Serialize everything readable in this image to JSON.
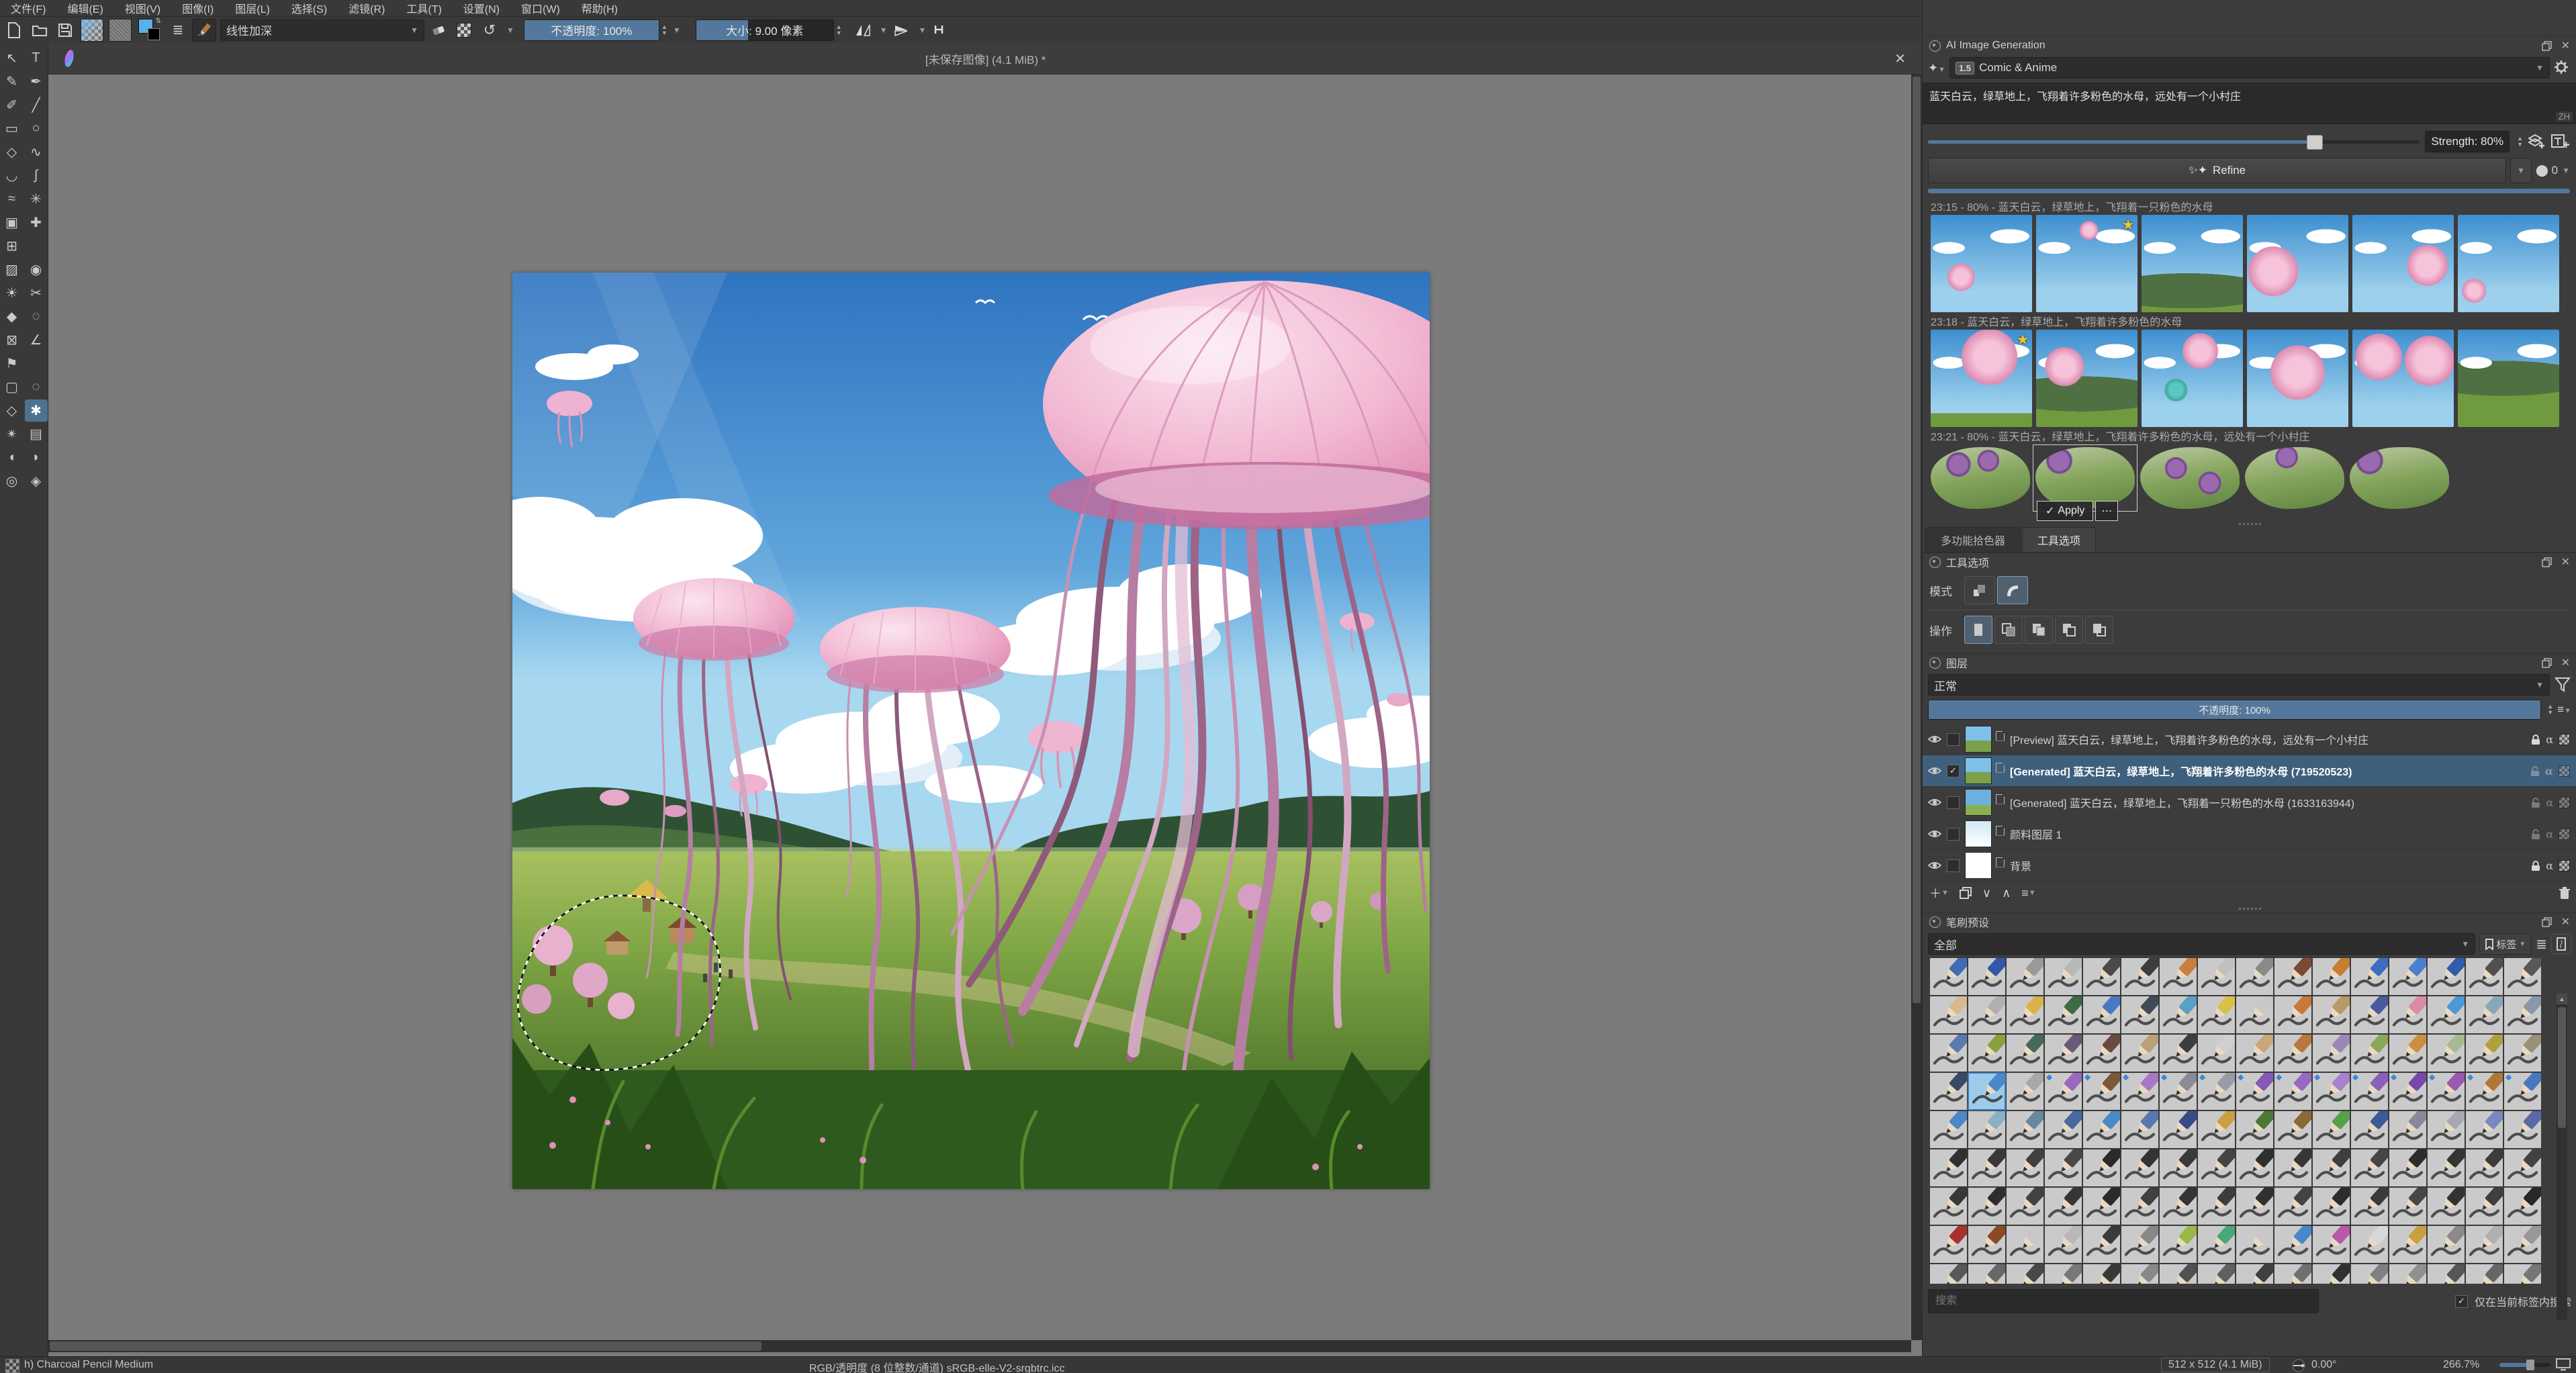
{
  "menu": {
    "items": [
      "文件(F)",
      "编辑(E)",
      "视图(V)",
      "图像(I)",
      "图层(L)",
      "选择(S)",
      "滤镜(R)",
      "工具(T)",
      "设置(N)",
      "窗口(W)",
      "帮助(H)"
    ]
  },
  "toolbar": {
    "blend_mode": "线性加深",
    "opacity_label": "不透明度:  100%",
    "size_label": "大小:  9.00 像素",
    "opacity_pct": 100,
    "size_fill_pct": 38
  },
  "window": {
    "title": "[未保存图像] (4.1 MiB) *",
    "close_label": "✕"
  },
  "tools": {
    "items": [
      {
        "n": "shape-select-tool",
        "g": "↖"
      },
      {
        "n": "text-tool",
        "g": "T"
      },
      {
        "n": "edit-shapes-tool",
        "g": "✎"
      },
      {
        "n": "calligraphy-tool",
        "g": "✒"
      },
      {
        "n": "freehand-brush-tool",
        "g": "✐"
      },
      {
        "n": "line-tool",
        "g": "╱"
      },
      {
        "n": "rectangle-tool",
        "g": "▭"
      },
      {
        "n": "ellipse-tool",
        "g": "○"
      },
      {
        "n": "polygon-tool",
        "g": "◇"
      },
      {
        "n": "polyline-tool",
        "g": "∿"
      },
      {
        "n": "bezier-curve-tool",
        "g": "◡"
      },
      {
        "n": "freehand-path-tool",
        "g": "∫"
      },
      {
        "n": "dynamic-brush-tool",
        "g": "≈"
      },
      {
        "n": "multibrush-tool",
        "g": "✳"
      },
      {
        "n": "transform-tool",
        "g": "▣"
      },
      {
        "n": "move-tool",
        "g": "✚"
      },
      {
        "n": "crop-tool",
        "g": "⊞"
      },
      {
        "n": "spacer",
        "g": ""
      },
      {
        "n": "gradient-tool",
        "g": "▨"
      },
      {
        "n": "color-sampler-tool",
        "g": "◉"
      },
      {
        "n": "colorize-mask-tool",
        "g": "☀"
      },
      {
        "n": "smart-patch-tool",
        "g": "✂"
      },
      {
        "n": "fill-tool",
        "g": "◆"
      },
      {
        "n": "enclose-fill-tool",
        "g": "◌"
      },
      {
        "n": "assistants-tool",
        "g": "⊠"
      },
      {
        "n": "measure-tool",
        "g": "∠"
      },
      {
        "n": "reference-images-tool",
        "g": "⚑"
      },
      {
        "n": "spacer",
        "g": ""
      },
      {
        "n": "rect-select-tool",
        "g": "▢"
      },
      {
        "n": "ellipse-select-tool",
        "g": "◌"
      },
      {
        "n": "polygon-select-tool",
        "g": "◇"
      },
      {
        "n": "freehand-select-tool",
        "g": "✱",
        "active": true
      },
      {
        "n": "magnetic-select-tool",
        "g": "✴"
      },
      {
        "n": "similar-select-tool",
        "g": "▤"
      },
      {
        "n": "bezier-select-tool",
        "g": "◖"
      },
      {
        "n": "freehand-select2-tool",
        "g": "◗"
      },
      {
        "n": "zoom-tool",
        "g": "◎"
      },
      {
        "n": "pan-tool",
        "g": "◈"
      }
    ]
  },
  "ai": {
    "title": "AI Image Generation",
    "style_badge": "1.5",
    "style": "Comic & Anime",
    "prompt": "蓝天白云，绿草地上，飞翔着许多粉色的水母，远处有一个小村庄",
    "lang_badge": "ZH",
    "strength_label": "Strength: 80%",
    "strength_pct": 80,
    "refine_label": "Refine",
    "queue_label": "0",
    "apply_label": "Apply",
    "more_label": "⋯",
    "history": [
      {
        "label": "23:15 - 80% - 蓝天白云，绿草地上，飞翔着一只粉色的水母",
        "star": 1,
        "selected": -1,
        "type": "sky",
        "thumbs": [
          {
            "p": [
              30,
              64,
              14
            ],
            "g": 0,
            "m": 0
          },
          {
            "p": [
              52,
              16,
              9
            ],
            "g": 0,
            "m": 0
          },
          {
            "p": null,
            "g": 14,
            "m": 1
          },
          {
            "p": [
              26,
              58,
              26
            ],
            "g": 0,
            "m": 0
          },
          {
            "p": [
              74,
              52,
              22
            ],
            "g": 0,
            "m": 0
          },
          {
            "p": [
              16,
              78,
              10
            ],
            "g": 0,
            "m": 0
          }
        ]
      },
      {
        "label": "23:18 - 蓝天白云，绿草地上，飞翔着许多粉色的水母",
        "star": 0,
        "selected": -1,
        "type": "jelly",
        "thumbs": [
          {
            "p": [
              58,
              28,
              30
            ],
            "g": 14,
            "m": 0
          },
          {
            "p": [
              28,
              38,
              20
            ],
            "g": 26,
            "m": 1
          },
          {
            "p": [
              58,
              22,
              18
            ],
            "g": 0,
            "m": 0,
            "t": [
              34,
              62,
              12
            ]
          },
          {
            "p": [
              50,
              44,
              36
            ],
            "g": 0,
            "m": 0
          },
          {
            "p": [
              26,
              28,
              22
            ],
            "g": 0,
            "m": 0,
            "p2": [
              76,
              32,
              24
            ]
          },
          {
            "p": null,
            "g": 42,
            "m": 1
          }
        ]
      },
      {
        "label": "23:21 - 80% - 蓝天白云，绿草地上，飞翔着许多粉色的水母，远处有一个小村庄",
        "star": -1,
        "selected": 1,
        "type": "meadow",
        "thumbs": [
          {
            "d": [
              [
                28,
                28
              ],
              [
                58,
                22
              ]
            ]
          },
          {
            "d": [
              [
                24,
                22
              ]
            ]
          },
          {
            "d": [
              [
                36,
                34
              ],
              [
                70,
                58
              ]
            ]
          },
          {
            "d": [
              [
                42,
                16
              ]
            ]
          },
          {
            "d": [
              [
                20,
                22
              ]
            ]
          }
        ]
      }
    ]
  },
  "tabs": {
    "picker": "多功能拾色器",
    "tool_options": "工具选项"
  },
  "tool_options": {
    "title": "工具选项",
    "mode_label": "模式",
    "action_label": "操作"
  },
  "layers": {
    "title": "图层",
    "blend": "正常",
    "opacity_label": "不透明度:  100%",
    "rows": [
      {
        "label": "[Preview] 蓝天白云，绿草地上，飞翔着许多粉色的水母，远处有一个小村庄",
        "locked": true,
        "checked": false,
        "selected": false,
        "thumb": "scene"
      },
      {
        "label": "[Generated] 蓝天白云，绿草地上，飞翔着许多粉色的水母 (719520523)",
        "locked": false,
        "checked": true,
        "selected": true,
        "thumb": "scene"
      },
      {
        "label": "[Generated] 蓝天白云，绿草地上，飞翔着一只粉色的水母 (1633163944)",
        "locked": false,
        "checked": false,
        "selected": false,
        "thumb": "sky"
      },
      {
        "label": "颜料图层 1",
        "locked": false,
        "checked": false,
        "selected": false,
        "thumb": "pale"
      },
      {
        "label": "背景",
        "locked": true,
        "checked": false,
        "selected": false,
        "thumb": "white"
      }
    ]
  },
  "brushes": {
    "title": "笔刷预设",
    "filter_all": "全部",
    "tag_label": "标签",
    "search_placeholder": "搜索",
    "search_note": "仅在当前标签内搜索",
    "cols": 16,
    "selected_index": 49,
    "rows": [
      [
        "#3f6cb4",
        "#3358a8",
        "#9a9a9a",
        "#b8b8b8",
        "#4a4a4a",
        "#3d3d3d",
        "#c8803c",
        "#c0c0c0",
        "#8a8a8a",
        "#7a4a34",
        "#c87c34",
        "#3e6cc0",
        "#4a80cc",
        "#2f5cac",
        "#505050",
        "#585858"
      ],
      [
        "#d8b890",
        "#b0b0b0",
        "#d8b34a",
        "#3e6b46",
        "#4a78c4",
        "#404a58",
        "#58a0c8",
        "#d8c04a",
        "#c8c8c8",
        "#c87838",
        "#b89a68",
        "#4a5a9c",
        "#d88aa8",
        "#4a9ad8",
        "#88a8b8",
        "#8898a8"
      ],
      [
        "#5a7ab0",
        "#8aa040",
        "#486858",
        "#6a5a78",
        "#6a4a3c",
        "#b8a078",
        "#3c3c44",
        "#d0d0d0",
        "#c8a878",
        "#b87840",
        "#9a88b8",
        "#88a858",
        "#c89040",
        "#a8b890",
        "#b0a040",
        "#989078"
      ],
      [
        "#3a4a66",
        "#4a88c8",
        "#a8a8a8",
        "#9a68c0",
        "#7a5838",
        "#a878c8",
        "#8a8a98",
        "#9a9aa8",
        "#8858b8",
        "#9868c4",
        "#a880d0",
        "#8a60b8",
        "#7848a8",
        "#9a58b0",
        "#b07838",
        "#4a78c0"
      ],
      [
        "#4a88c8",
        "#88b0c8",
        "#6888a0",
        "#4868a0",
        "#4a88c8",
        "#5878b0",
        "#384a88",
        "#c8a040",
        "#4a7838",
        "#8a6838",
        "#58a048",
        "#3a5a98",
        "#888898",
        "#a8a8b0",
        "#7888c0",
        "#5868a8"
      ],
      [
        "#303030",
        "#383838",
        "#404040",
        "#484848",
        "#2a2a2a",
        "#333333",
        "#3a3a3a",
        "#444444",
        "#2e2e2e",
        "#363636",
        "#3e3e3e",
        "#464646",
        "#2c2c2c",
        "#343434",
        "#3c3c3c",
        "#424242"
      ],
      [
        "#383838",
        "#2e2e2e",
        "#424242",
        "#363636",
        "#2a2a2a",
        "#404040",
        "#343434",
        "#3c3c3c",
        "#303030",
        "#444444",
        "#2c2c2c",
        "#3a3a3a",
        "#464646",
        "#323232",
        "#3e3e3e",
        "#282828"
      ],
      [
        "#a83030",
        "#8a4a28",
        "#c8c8c8",
        "#b8b8b8",
        "#3a3a3a",
        "#888888",
        "#98b848",
        "#48a878",
        "#c8c8c8",
        "#4888c8",
        "#b858a8",
        "#d8d8d8",
        "#c8a040",
        "#8a8a8a",
        "#b0b0b0",
        "#989898"
      ],
      [
        "#585858",
        "#686868",
        "#484848",
        "#787878",
        "#383838",
        "#888888",
        "#505050",
        "#606060",
        "#404040",
        "#707070",
        "#303030",
        "#808080",
        "#909090",
        "#565656",
        "#666666",
        "#767676"
      ]
    ]
  },
  "status": {
    "preset": "h) Charcoal Pencil Medium",
    "colorspace": "RGB/透明度 (8 位整数/通道)  sRGB-elle-V2-srgbtrc.icc",
    "size": "512 x 512 (4.1 MiB)",
    "angle": "0.00°",
    "zoom": "266.7%"
  },
  "colors": {
    "accent_blue": "#54789c",
    "selection_row": "#3f607c",
    "canvas_surround": "#7b7b7b",
    "tile_selected": "#9ecbea"
  }
}
